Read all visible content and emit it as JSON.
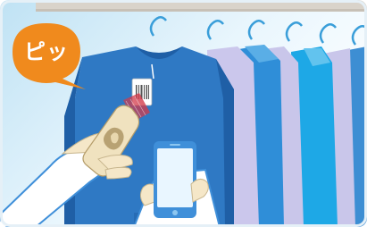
{
  "speech_bubble": {
    "text": "ピッ"
  },
  "colors": {
    "background_gradient_start": "#cfe9f6",
    "background_gradient_end": "#ffffff",
    "hanger_rail": "#d8d2c9",
    "shirt_front": "#2f79c4",
    "shirt_front_dark": "#1f5fa6",
    "shirt_lavender": "#c9c6ea",
    "shirt_cyan": "#1ea8e6",
    "shirt_blue": "#3d8ed3",
    "hand": "#f5e7c8",
    "reader": "#f0e2bf",
    "phone": "#3f8fd9",
    "phone_screen": "#e9f6ff",
    "bubble": "#f08a1d",
    "scan_beam": "#d23a4a",
    "frame_border": "#e5f0f7"
  },
  "icons": {
    "bubble": "speech-bubble",
    "reader": "handheld-rfid-reader",
    "phone": "smartphone",
    "tag": "rfid-tag"
  }
}
